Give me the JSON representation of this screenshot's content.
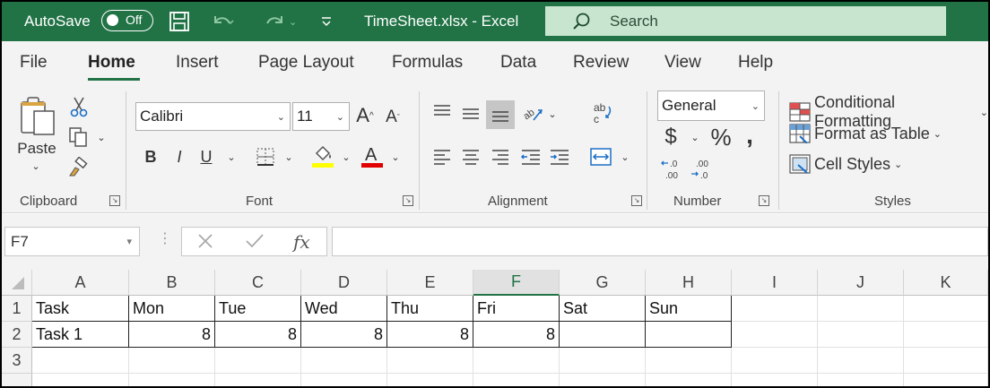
{
  "titlebar": {
    "autosave_label": "AutoSave",
    "autosave_state": "Off",
    "file_title": "TimeSheet.xlsx  -  Excel",
    "search_placeholder": "Search"
  },
  "tabs": [
    "File",
    "Home",
    "Insert",
    "Page Layout",
    "Formulas",
    "Data",
    "Review",
    "View",
    "Help"
  ],
  "active_tab": "Home",
  "ribbon": {
    "clipboard": {
      "paste_label": "Paste",
      "group_label": "Clipboard"
    },
    "font": {
      "font_name": "Calibri",
      "font_size": "11",
      "group_label": "Font",
      "bold": "B",
      "italic": "I",
      "underline": "U"
    },
    "alignment": {
      "group_label": "Alignment"
    },
    "number": {
      "format": "General",
      "currency": "$",
      "percent": "%",
      "comma": ",",
      "group_label": "Number"
    },
    "styles": {
      "conditional_formatting": "Conditional Formatting",
      "format_as_table": "Format as Table",
      "cell_styles": "Cell Styles",
      "group_label": "Styles"
    }
  },
  "formula_bar": {
    "name_box": "F7",
    "fx": "fx",
    "formula": ""
  },
  "grid": {
    "columns": [
      "A",
      "B",
      "C",
      "D",
      "E",
      "F",
      "G",
      "H",
      "I",
      "J",
      "K"
    ],
    "selected_column": "F",
    "rows": [
      "1",
      "2",
      "3"
    ],
    "cells": {
      "row1": [
        "Task",
        "Mon",
        "Tue",
        "Wed",
        "Thu",
        "Fri",
        "Sat",
        "Sun"
      ],
      "row2": [
        "Task 1",
        "8",
        "8",
        "8",
        "8",
        "8",
        "",
        ""
      ]
    }
  },
  "colors": {
    "accent": "#217346",
    "font_highlight": "#ffff00",
    "font_color": "#e00000"
  }
}
